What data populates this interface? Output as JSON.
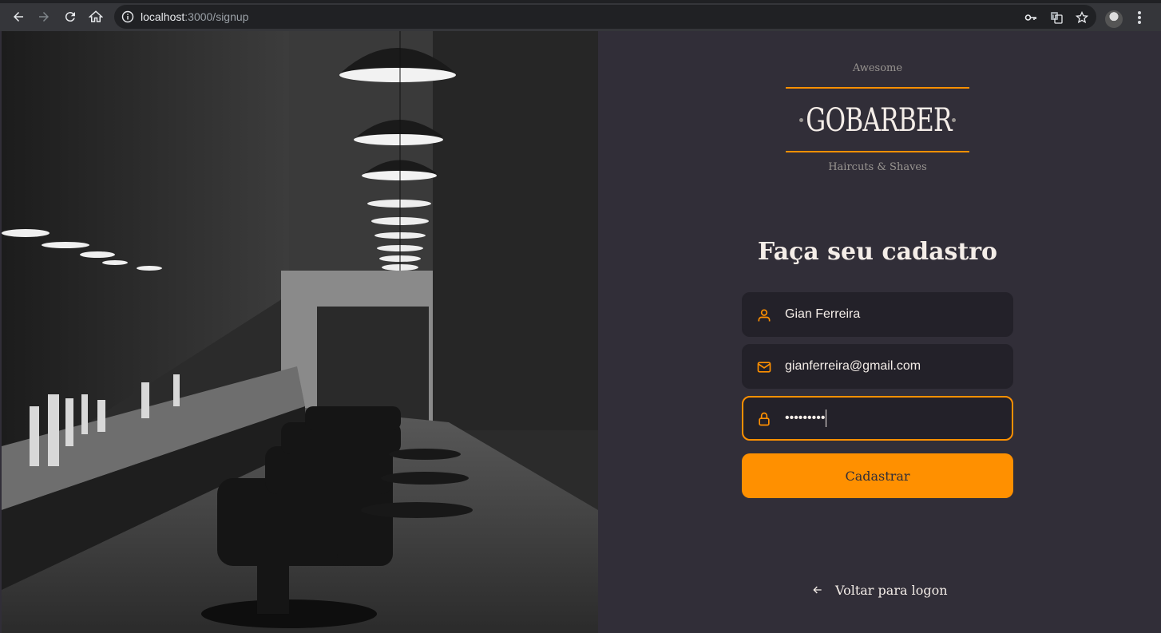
{
  "browser": {
    "url_host": "localhost",
    "url_rest": ":3000/signup"
  },
  "logo": {
    "top_text": "Awesome",
    "wordmark": "GOBARBER",
    "bottom_text": "Haircuts & Shaves",
    "accent_color": "#ff9000"
  },
  "form": {
    "title": "Faça seu cadastro",
    "name_value": "Gian Ferreira",
    "email_value": "gianferreira@gmail.com",
    "password_value": "•••••••••",
    "submit_label": "Cadastrar"
  },
  "back_link": {
    "label": "Voltar para logon"
  },
  "colors": {
    "background": "#312e38",
    "input_bg": "#232129",
    "text": "#f4ede8",
    "muted": "#999591",
    "accent": "#ff9000"
  },
  "icons": {
    "name_field": "user-icon",
    "email_field": "mail-icon",
    "password_field": "lock-icon",
    "back": "arrow-left-icon"
  }
}
